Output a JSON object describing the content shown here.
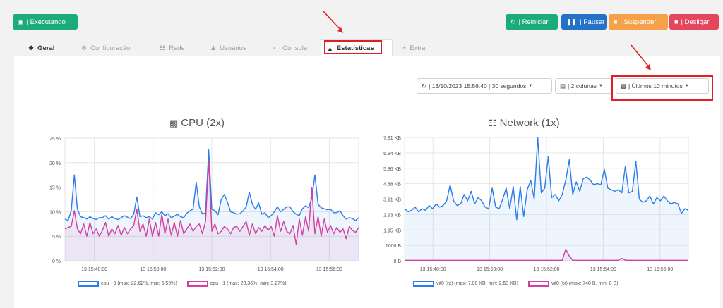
{
  "toolbar": {
    "status_label": "| Executando",
    "restart_label": "| Reiniciar",
    "pause_label": "| Pausar",
    "suspend_label": "| Suspender",
    "shutdown_label": "| Desligar"
  },
  "tabs": [
    {
      "label": "Geral",
      "icon": "info-icon"
    },
    {
      "label": "Configuração",
      "icon": "gear-icon"
    },
    {
      "label": "Rede",
      "icon": "network-icon"
    },
    {
      "label": "Usuários",
      "icon": "user-icon"
    },
    {
      "label": "Console",
      "icon": "terminal-icon"
    },
    {
      "label": "Estatísticas",
      "icon": "area-chart-icon",
      "active": true
    },
    {
      "label": "Extra",
      "icon": "plus-icon"
    }
  ],
  "controls": {
    "refresh": "| 13/10/2023 15:56:40 | 30 segundos",
    "columns": "| 2 colunas",
    "range": "| Últimos 10 minutos"
  },
  "colors": {
    "green": "#1cab7b",
    "blue": "#2472c8",
    "orange": "#f6a14a",
    "red": "#e4465e",
    "series_blue": "#2b7de9",
    "series_pink": "#d23fa0",
    "highlight": "#e02020"
  },
  "chart_data": [
    {
      "type": "area",
      "title": "CPU (2x)",
      "x_ticks": [
        "13 15:48:00",
        "13 15:50:00",
        "13 15:52:00",
        "13 15:54:00",
        "13 15:56:00"
      ],
      "y_ticks": [
        "25 %",
        "20 %",
        "15 %",
        "10 %",
        "5 %",
        "0 %"
      ],
      "ylim": [
        0,
        25
      ],
      "grid": true,
      "legend_position": "bottom",
      "series": [
        {
          "name": "cpu - 0 (max: 22.62%, min: 6.59%)",
          "color": "#2b7de9",
          "values": [
            8.5,
            8.2,
            10.2,
            17.5,
            10.5,
            9,
            8.8,
            8.5,
            9,
            8.6,
            8.4,
            8.8,
            8.8,
            9.2,
            8.5,
            9,
            8.6,
            8.4,
            8.8,
            9.2,
            8.9,
            8.6,
            9.5,
            13,
            9,
            9.2,
            8.8,
            9,
            8.5,
            9.8,
            9.4,
            10,
            9.2,
            9.6,
            8.8,
            9.1,
            9.5,
            9,
            8.8,
            9.7,
            10.2,
            10.5,
            16,
            11,
            9.5,
            9.8,
            22.6,
            10.5,
            10.2,
            9.4,
            12.5,
            13.5,
            12,
            10,
            9.8,
            9.5,
            9.6,
            10.2,
            11,
            14,
            11.5,
            10.5,
            11.8,
            9.5,
            9.8,
            8.8,
            9.2,
            10,
            11,
            10,
            10.5,
            11,
            11,
            10,
            9.5,
            9.2,
            10.6,
            11.2,
            10.8,
            12.8,
            17.5,
            11.5,
            10.8,
            10.6,
            10.4,
            10.5,
            9.8,
            9.8,
            10.2,
            9.2,
            8.5,
            8.8,
            8.6,
            8.2,
            8.8
          ]
        },
        {
          "name": "cpu - 1 (max: 20.36%, min: 3.27%)",
          "color": "#d23fa0",
          "values": [
            6.5,
            6.8,
            7,
            10.2,
            6.5,
            5.5,
            7.5,
            5,
            7.8,
            5.5,
            6.5,
            5,
            6.2,
            7.8,
            5,
            6.5,
            5.5,
            7.2,
            5.2,
            6.8,
            5.5,
            6.5,
            7.2,
            10.5,
            6,
            7.5,
            5,
            8.5,
            5,
            7.8,
            5,
            9.5,
            5.5,
            8.5,
            5.2,
            7.8,
            5,
            8.2,
            5.5,
            6.5,
            7.5,
            6,
            7,
            7.5,
            5.5,
            8,
            20.4,
            6,
            7.5,
            5.5,
            6,
            7,
            6.5,
            5.5,
            6.8,
            7,
            6,
            7,
            8,
            5.2,
            7.5,
            5.5,
            6.8,
            6,
            7.2,
            6.2,
            7,
            5,
            9.2,
            6,
            8,
            6,
            5.5,
            7.2,
            3.3,
            8.5,
            5.2,
            9,
            6,
            15,
            5.5,
            9,
            5,
            8.5,
            5.8,
            7.2,
            5.5,
            6.8,
            5.8,
            6.5,
            4.5,
            7,
            6.2,
            5.8,
            6.8
          ]
        }
      ]
    },
    {
      "type": "area",
      "title": "Network (1x)",
      "x_ticks": [
        "13 15:48:00",
        "13 15:50:00",
        "13 15:52:00",
        "13 15:54:00",
        "13 15:56:00"
      ],
      "y_ticks": [
        "7.81 KB",
        "6.84 KB",
        "5.86 KB",
        "4.88 KB",
        "3.91 KB",
        "2.93 KB",
        "1.95 KB",
        "1000 B",
        "0 B"
      ],
      "ylim": [
        0,
        7.81
      ],
      "grid": true,
      "legend_position": "bottom",
      "series": [
        {
          "name": "vif0 (rx) (max: 7.80 KB, min: 2.53 KB)",
          "color": "#2b7de9",
          "values": [
            3.3,
            3.1,
            3.2,
            3.4,
            3.1,
            3.3,
            3.2,
            3.5,
            3.3,
            3.6,
            3.4,
            3.5,
            3.8,
            4.8,
            3.8,
            3.5,
            3.6,
            4.2,
            3.8,
            4.4,
            3.6,
            4.0,
            3.8,
            3.4,
            3.3,
            4.6,
            3.4,
            3.3,
            3.9,
            4.6,
            3.3,
            4.7,
            2.6,
            4.7,
            2.8,
            4.5,
            5.1,
            3.9,
            7.8,
            4.3,
            4.6,
            6.6,
            4.0,
            4.2,
            3.8,
            4.2,
            5.1,
            6.4,
            4.2,
            5.0,
            4.4,
            5.2,
            5.3,
            5.1,
            4.8,
            4.9,
            4.8,
            5.8,
            4.6,
            4.5,
            4.4,
            4.5,
            4.3,
            6.0,
            4.3,
            4.4,
            6.3,
            3.9,
            3.7,
            3.8,
            4.1,
            3.6,
            4.0,
            3.8,
            4.1,
            3.8,
            3.6,
            3.7,
            3.6,
            3.0,
            3.3,
            3.2
          ]
        },
        {
          "name": "vif0 (tx) (max: 740 B, min: 0 B)",
          "color": "#d23fa0",
          "values": [
            0.03,
            0.03,
            0.03,
            0.03,
            0.03,
            0.03,
            0.03,
            0.03,
            0.03,
            0.03,
            0.03,
            0.03,
            0.03,
            0.03,
            0.03,
            0.03,
            0.03,
            0.03,
            0.03,
            0.03,
            0.03,
            0.03,
            0.03,
            0.03,
            0.03,
            0.03,
            0.03,
            0.03,
            0.03,
            0.03,
            0.03,
            0.03,
            0.03,
            0.03,
            0.03,
            0.03,
            0.03,
            0.03,
            0.03,
            0.03,
            0.03,
            0.03,
            0.03,
            0.03,
            0.03,
            0.03,
            0.74,
            0.3,
            0.03,
            0.03,
            0.03,
            0.03,
            0.03,
            0.03,
            0.03,
            0.03,
            0.03,
            0.03,
            0.03,
            0.03,
            0.03,
            0.03,
            0.15,
            0.03,
            0.03,
            0.03,
            0.03,
            0.03,
            0.03,
            0.03,
            0.03,
            0.03,
            0.03,
            0.03,
            0.03,
            0.03,
            0.03,
            0.03,
            0.03,
            0.03,
            0.03,
            0.03
          ]
        }
      ]
    }
  ]
}
